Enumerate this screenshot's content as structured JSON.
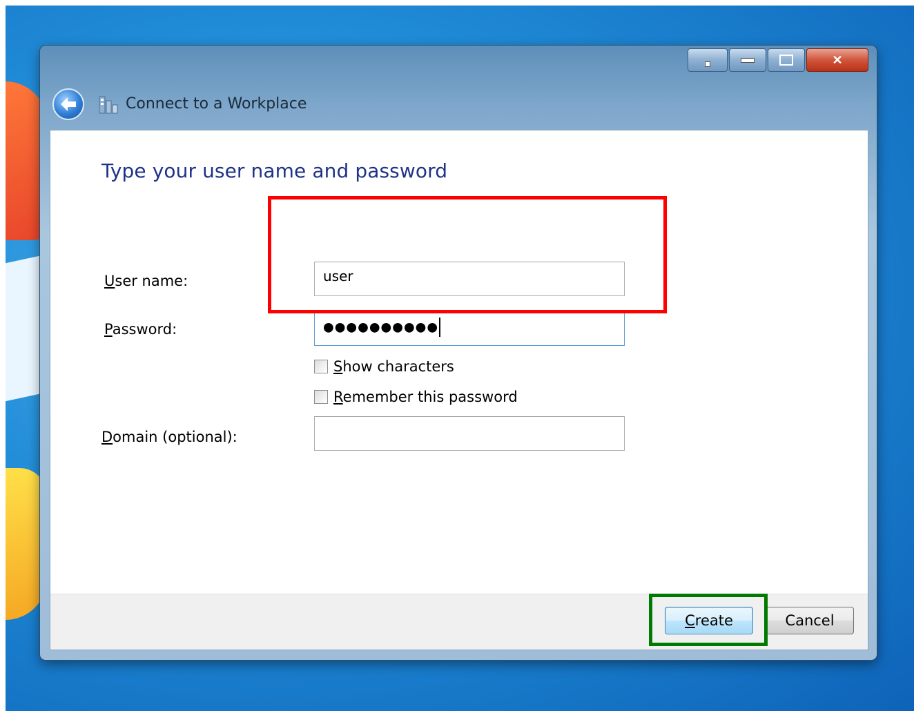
{
  "window": {
    "title": "Connect to a Workplace",
    "controls": [
      "extra",
      "minimize",
      "maximize",
      "close"
    ]
  },
  "content": {
    "heading": "Type your user name and password",
    "fields": {
      "username": {
        "label_prefix": "",
        "label_mn": "U",
        "label_rest": "ser name:",
        "value": "user"
      },
      "password": {
        "label_mn": "P",
        "label_rest": "assword:",
        "masked_value": "●●●●●●●●●●"
      },
      "domain": {
        "label_mn": "D",
        "label_rest": "omain (optional):",
        "value": ""
      }
    },
    "checkboxes": {
      "show_characters": {
        "mn": "S",
        "rest": "how characters",
        "checked": false
      },
      "remember_password": {
        "mn": "R",
        "rest": "emember this password",
        "checked": false
      }
    }
  },
  "footer": {
    "create": {
      "mn": "C",
      "rest": "reate"
    },
    "cancel": "Cancel"
  },
  "annotations": {
    "red_box_color": "#ff0000",
    "green_box_color": "#007a00"
  },
  "icons": [
    "back-arrow-icon",
    "network-workplace-icon",
    "close-icon",
    "minimize-icon",
    "maximize-icon"
  ]
}
